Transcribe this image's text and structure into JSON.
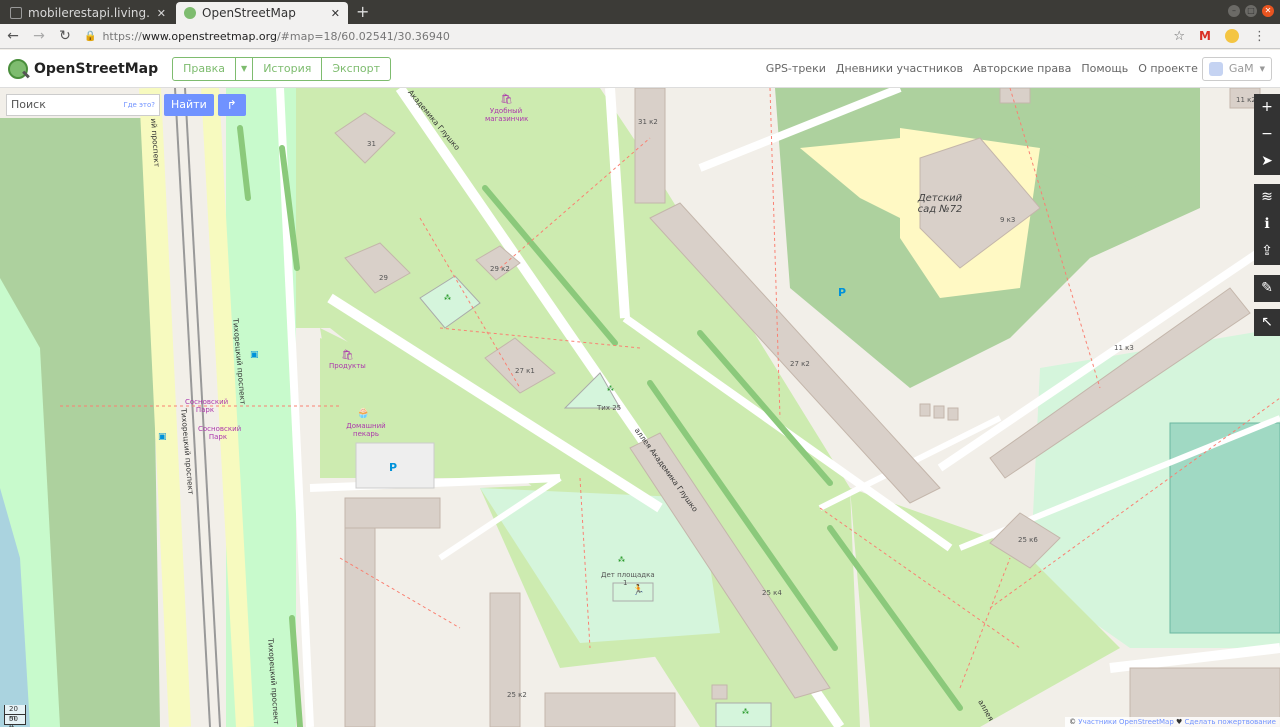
{
  "browser": {
    "tabs": [
      {
        "title": "mobilerestapi.living.local",
        "active": false
      },
      {
        "title": "OpenStreetMap",
        "active": true
      }
    ],
    "newtab": "+",
    "url_prefix": "https://",
    "url_host": "www.openstreetmap.org",
    "url_rest": "/#map=18/60.02541/30.36940"
  },
  "header": {
    "logo": "OpenStreetMap",
    "edit": "Правка",
    "history": "История",
    "export": "Экспорт",
    "links": [
      "GPS-треки",
      "Дневники участников",
      "Авторские права",
      "Помощь",
      "О проекте"
    ],
    "user": "GaM"
  },
  "search": {
    "placeholder": "Поиск",
    "where": "Где это?",
    "find": "Найти"
  },
  "map_labels": {
    "b31": "31",
    "b29": "29",
    "b29k2": "29 к2",
    "b27k1": "27 к1",
    "b27k2": "27 к2",
    "b31k2": "31 к2",
    "b9k3": "9 к3",
    "b11k3": "11 к3",
    "b25k4": "25 к4",
    "b25k2": "25 к2",
    "b25k6": "25 к6",
    "b11k2": "11 к2",
    "shop1": "Удобный магазинчик",
    "shop2": "Продукты",
    "bakery": "Домашний пекарь",
    "kinder": "Детский сад №72",
    "tih25": "Тих 25",
    "playground": "Дет площадка",
    "pg1": "1",
    "park1": "Сосновский Парк",
    "park2": "Сосновский Парк",
    "road1": "аллея Академика Глушко",
    "road2": "Академика Глушко",
    "road3": "Тихорецкий проспект",
    "road4": "Тихорецкий проспект",
    "road5": "Тихорецкий проспект",
    "road6": "ий проспект",
    "road7": "аллея"
  },
  "scale": {
    "m": "20 m",
    "ft": "50 ft"
  },
  "attribution": {
    "prefix": "© ",
    "link": "Участники OpenStreetMap",
    "sep": " ♥ ",
    "donate": "Сделать пожертвование"
  },
  "colors": {
    "osm_green": "#7ebc6f",
    "button_blue": "#7092ff",
    "park": "#c8facc",
    "forest": "#add19e",
    "building": "#d9d0c9"
  }
}
